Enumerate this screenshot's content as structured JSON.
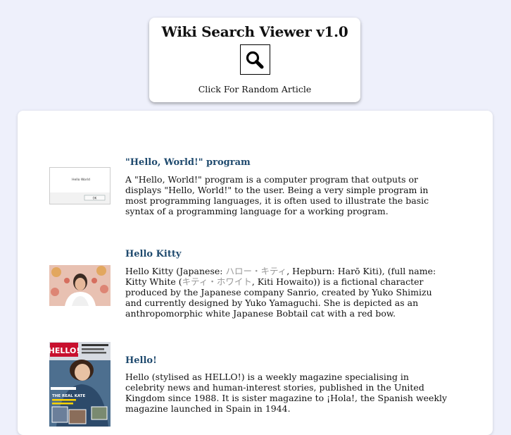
{
  "header": {
    "title": "Wiki Search Viewer v1.0",
    "search_icon": "search-icon",
    "random_label": "Click For Random Article"
  },
  "results": [
    {
      "title": "\"Hello, World!\" program",
      "extract": "A \"Hello, World!\" program is a computer program that outputs or displays \"Hello, World!\" to the user. Being a very simple program in most programming languages, it is often used to illustrate the basic syntax of a programming language for a working program.",
      "thumb_text": "Hello World",
      "thumb_button": "OK"
    },
    {
      "title": "Hello Kitty",
      "extract_parts": {
        "p1": "Hello Kitty (Japanese: ",
        "jp1": "ハロー・キティ",
        "p2": ", Hepburn: Harō Kiti), (full name: Kitty White (",
        "jp2": "キティ・ホワイト",
        "p3": ", Kiti Howaito)) is a fictional character produced by the Japanese company Sanrio, created by Yuko Shimizu and currently designed by Yuko Yamaguchi. She is depicted as an anthropomorphic white Japanese Bobtail cat with a red bow."
      }
    },
    {
      "title": "Hello!",
      "extract": "Hello (stylised as HELLO!) is a weekly magazine specialising in celebrity news and human-interest stories, published in the United Kingdom since 1988. It is sister magazine to ¡Hola!, the Spanish weekly magazine launched in Spain in 1944.",
      "thumb_logo": "HELLO!",
      "thumb_headline": "THE REAL KATE"
    }
  ],
  "colors": {
    "page_bg": "#eef0fb",
    "card_bg": "#ffffff",
    "title_link": "#1f4a6e",
    "japanese_text": "#999999"
  }
}
